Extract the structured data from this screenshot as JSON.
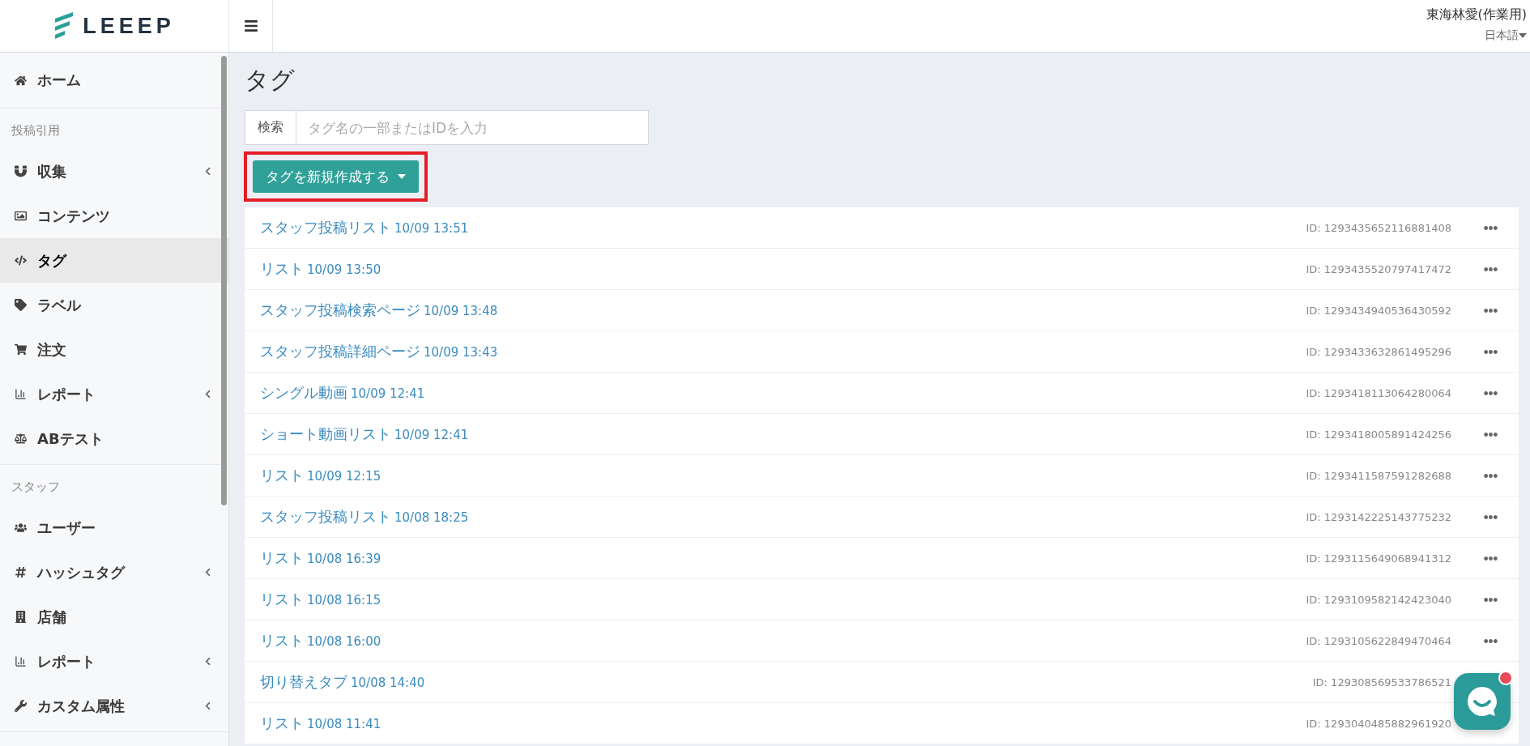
{
  "header": {
    "logo": "LEEEP",
    "user": "東海林愛(作業用)",
    "language": "日本語"
  },
  "sidebar": {
    "home": {
      "label": "ホーム",
      "selected": false
    },
    "sections": [
      {
        "title": "投稿引用",
        "items": [
          {
            "label": "収集",
            "expandable": true,
            "selected": false
          },
          {
            "label": "コンテンツ",
            "expandable": false,
            "selected": false
          },
          {
            "label": "タグ",
            "expandable": false,
            "selected": true
          },
          {
            "label": "ラベル",
            "expandable": false,
            "selected": false
          },
          {
            "label": "注文",
            "expandable": false,
            "selected": false
          },
          {
            "label": "レポート",
            "expandable": true,
            "selected": false
          },
          {
            "label": "ABテスト",
            "expandable": false,
            "selected": false
          }
        ]
      },
      {
        "title": "スタッフ",
        "items": [
          {
            "label": "ユーザー",
            "expandable": false,
            "selected": false
          },
          {
            "label": "ハッシュタグ",
            "expandable": true,
            "selected": false
          },
          {
            "label": "店舗",
            "expandable": false,
            "selected": false
          },
          {
            "label": "レポート",
            "expandable": true,
            "selected": false
          },
          {
            "label": "カスタム属性",
            "expandable": true,
            "selected": false
          }
        ]
      }
    ]
  },
  "page": {
    "title": "タグ",
    "search": {
      "label": "検索",
      "placeholder": "タグ名の一部またはIDを入力"
    },
    "create_button": {
      "label": "タグを新規作成する",
      "highlighted": true
    }
  },
  "tags": [
    {
      "name": "スタッフ投稿リスト",
      "date": "10/09 13:51",
      "id": "ID: 1293435652116881408"
    },
    {
      "name": "リスト",
      "date": "10/09 13:50",
      "id": "ID: 1293435520797417472"
    },
    {
      "name": "スタッフ投稿検索ページ",
      "date": "10/09 13:48",
      "id": "ID: 1293434940536430592"
    },
    {
      "name": "スタッフ投稿詳細ページ",
      "date": "10/09 13:43",
      "id": "ID: 1293433632861495296"
    },
    {
      "name": "シングル動画",
      "date": "10/09 12:41",
      "id": "ID: 1293418113064280064"
    },
    {
      "name": "ショート動画リスト",
      "date": "10/09 12:41",
      "id": "ID: 1293418005891424256"
    },
    {
      "name": "リスト",
      "date": "10/09 12:15",
      "id": "ID: 1293411587591282688"
    },
    {
      "name": "スタッフ投稿リスト",
      "date": "10/08 18:25",
      "id": "ID: 1293142225143775232"
    },
    {
      "name": "リスト",
      "date": "10/08 16:39",
      "id": "ID: 1293115649068941312"
    },
    {
      "name": "リスト",
      "date": "10/08 16:15",
      "id": "ID: 1293109582142423040"
    },
    {
      "name": "リスト",
      "date": "10/08 16:00",
      "id": "ID: 1293105622849470464"
    },
    {
      "name": "切り替えタブ",
      "date": "10/08 14:40",
      "id": "ID: 129308569533786521"
    },
    {
      "name": "リスト",
      "date": "10/08 11:41",
      "id": "ID: 1293040485882961920"
    }
  ],
  "chat": {
    "unread": true
  }
}
